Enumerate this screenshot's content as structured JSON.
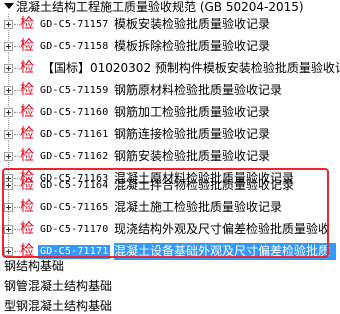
{
  "tree": {
    "root_label": "混凝土结构工程施工质量验收规范 (GB 50204-2015)",
    "mark_label": "检",
    "items": [
      {
        "code": "GD-C5-71157",
        "name": "模板安装检验批质量验收记录"
      },
      {
        "code": "GD-C5-71158",
        "name": "模板拆除检验批质量验收记录"
      },
      {
        "code": "",
        "name": "【国标】01020302 预制构件模板安装检验批质量验收记"
      },
      {
        "code": "GD-C5-71159",
        "name": "钢筋原材料检验批质量验收记录"
      },
      {
        "code": "GD-C5-71160",
        "name": "钢筋加工检验批质量验收记录"
      },
      {
        "code": "GD-C5-71161",
        "name": "钢筋连接检验批质量验收记录"
      },
      {
        "code": "GD-C5-71162",
        "name": "钢筋安装检验批质量验收记录"
      },
      {
        "code": "GD-C5-71163",
        "name": "混凝土原材料检验批质量验收记录"
      },
      {
        "code": "GD-C5-71164",
        "name": "混凝土拌合物检验批质量验收记录"
      },
      {
        "code": "GD-C5-71165",
        "name": "混凝土施工检验批质量验收记录"
      },
      {
        "code": "GD-C5-71170",
        "name": "现浇结构外观及尺寸偏差检验批质量验收"
      },
      {
        "code": "GD-C5-71171",
        "name": "混凝土设备基础外观及尺寸偏差检验批质"
      }
    ],
    "selected_index": 11,
    "lower_nodes": [
      "钢结构基础",
      "钢管混凝土结构基础",
      "型钢混凝土结构基础"
    ]
  },
  "colors": {
    "mark": "#e0001a",
    "selection": "#3399ff",
    "highlight_box": "#e8282e"
  }
}
